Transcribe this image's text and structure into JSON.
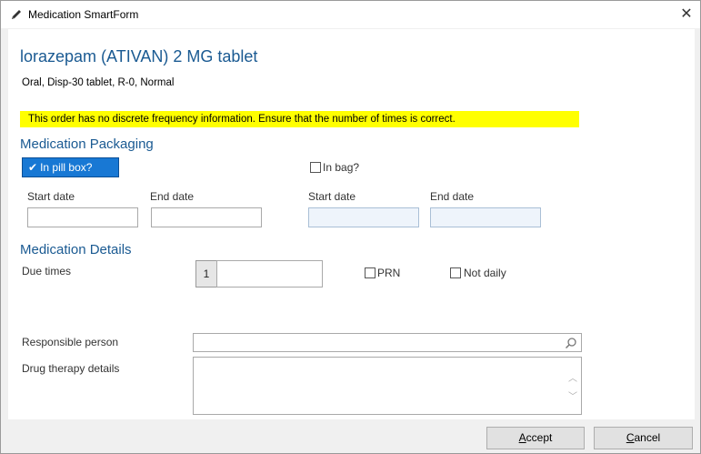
{
  "window": {
    "title": "Medication SmartForm",
    "close_symbol": "✕",
    "title_icon": "pencil-icon"
  },
  "drug": {
    "title": "lorazepam (ATIVAN) 2 MG tablet",
    "details": "Oral, Disp-30 tablet, R-0, Normal"
  },
  "warning": "This order has no discrete frequency information. Ensure that the number of times is correct.",
  "packaging": {
    "header": "Medication Packaging",
    "pill_box": {
      "label": "In pill box?",
      "checked": true,
      "start_label": "Start date",
      "end_label": "End date",
      "start_value": "",
      "end_value": ""
    },
    "bag": {
      "label": "In bag?",
      "checked": false,
      "start_label": "Start date",
      "end_label": "End date",
      "start_value": "",
      "end_value": ""
    }
  },
  "details": {
    "header": "Medication Details",
    "due_times_label": "Due times",
    "due_times_count": "1",
    "due_times_value": "",
    "prn_label": "PRN",
    "not_daily_label": "Not daily",
    "responsible_label": "Responsible person",
    "responsible_value": "",
    "therapy_label": "Drug therapy details",
    "therapy_value": ""
  },
  "buttons": {
    "accept_key": "A",
    "accept_rest": "ccept",
    "cancel_key": "C",
    "cancel_rest": "ancel"
  },
  "colors": {
    "accent": "#1a5a92",
    "checked_bg": "#1878d4",
    "warning_bg": "#ffff00"
  }
}
